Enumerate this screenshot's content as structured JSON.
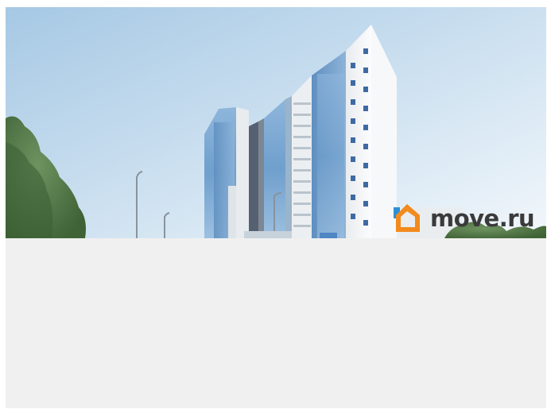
{
  "watermark": {
    "text": "move.ru",
    "logo_orange": "#f28a1d",
    "logo_blue": "#2d8fd8",
    "text_color": "#3a3a3a"
  },
  "colors": {
    "sky_top": "#a9cbe6",
    "sky_bottom": "#eef5fb",
    "glass": "#6f9fcd",
    "facade": "#f2f4f6",
    "foliage": "#4f7344",
    "placeholder_background": "#f0f0f0"
  }
}
